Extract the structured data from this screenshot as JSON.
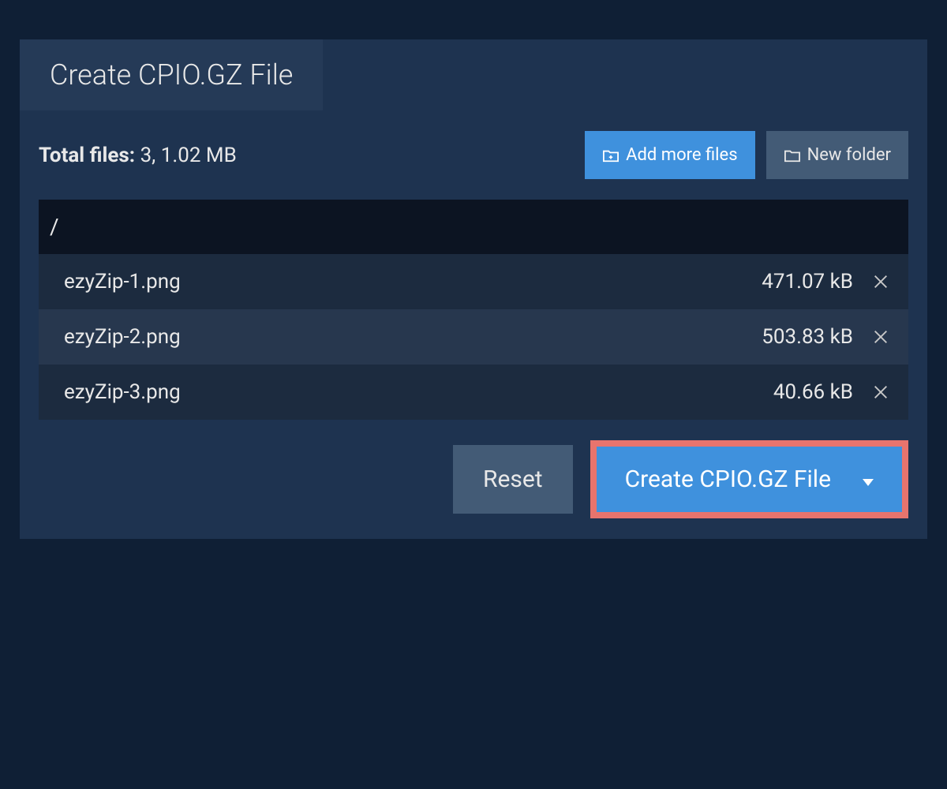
{
  "tab": {
    "title": "Create CPIO.GZ File"
  },
  "summary": {
    "label": "Total files:",
    "value": "3, 1.02 MB"
  },
  "buttons": {
    "add_more": "Add more files",
    "new_folder": "New folder",
    "reset": "Reset",
    "create": "Create CPIO.GZ File"
  },
  "path": "/",
  "files": [
    {
      "name": "ezyZip-1.png",
      "size": "471.07 kB"
    },
    {
      "name": "ezyZip-2.png",
      "size": "503.83 kB"
    },
    {
      "name": "ezyZip-3.png",
      "size": "40.66 kB"
    }
  ],
  "colors": {
    "accent": "#3f91dd",
    "highlight_border": "#e8746d",
    "bg_dark": "#0f1f35",
    "panel": "#1e3350"
  }
}
